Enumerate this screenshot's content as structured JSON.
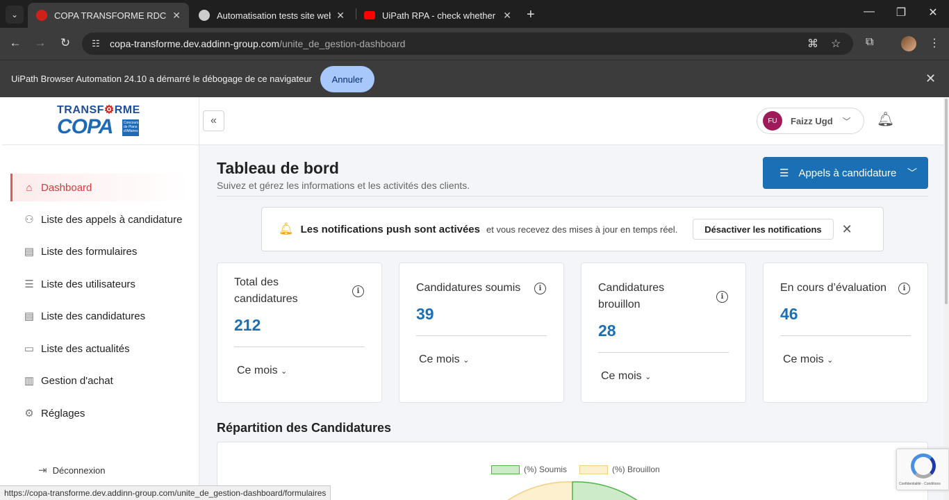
{
  "browser": {
    "tabs": [
      {
        "title": "COPA TRANSFORME RDC",
        "favicon_color": "#d0201a",
        "active": true
      },
      {
        "title": "Automatisation tests site web",
        "favicon_color": "#cccccc",
        "active": false
      },
      {
        "title": "UiPath RPA - check whether the",
        "favicon_color": "#ff0000",
        "active": false
      }
    ],
    "url_host": "copa-transforme.dev.addinn-group.com",
    "url_path": "/unite_de_gestion-dashboard",
    "infobar": {
      "message": "UiPath Browser Automation 24.10 a démarré le débogage de ce navigateur",
      "button": "Annuler"
    },
    "status_url": "https://copa-transforme.dev.addinn-group.com/unite_de_gestion-dashboard/formulaires"
  },
  "logo": {
    "line1_pre": "TRANSF",
    "line1_post": "RME",
    "line2": "COPA",
    "badge": "Concours de Plans d'Affaires"
  },
  "sidebar": {
    "items": [
      {
        "label": "Dashboard",
        "icon": "home-icon",
        "glyph": "⌂"
      },
      {
        "label": "Liste des appels à candidature",
        "icon": "megaphone-icon",
        "glyph": "⚇"
      },
      {
        "label": "Liste des formulaires",
        "icon": "form-icon",
        "glyph": "▤"
      },
      {
        "label": "Liste des utilisateurs",
        "icon": "users-list-icon",
        "glyph": "☰"
      },
      {
        "label": "Liste des candidatures",
        "icon": "document-icon",
        "glyph": "▤"
      },
      {
        "label": "Liste des actualités",
        "icon": "news-icon",
        "glyph": "▭"
      },
      {
        "label": "Gestion d'achat",
        "icon": "receipt-icon",
        "glyph": "▥"
      },
      {
        "label": "Réglages",
        "icon": "gear-icon",
        "glyph": "⚙"
      }
    ],
    "logout": "Déconnexion"
  },
  "user": {
    "initials": "FU",
    "name": "Faizz Ugd"
  },
  "header": {
    "title": "Tableau de bord",
    "subtitle": "Suivez et gérez les informations et les activités des clients.",
    "cta": "Appels à candidature"
  },
  "notification": {
    "strong": "Les notifications push sont activées",
    "text": "et vous recevez des mises à jour en temps réel.",
    "button": "Désactiver les notifications"
  },
  "cards": [
    {
      "title": "Total des candidatures",
      "value": "212",
      "period": "Ce mois"
    },
    {
      "title": "Candidatures soumis",
      "value": "39",
      "period": "Ce mois"
    },
    {
      "title": "Candidatures brouillon",
      "value": "28",
      "period": "Ce mois"
    },
    {
      "title": "En cours d’évaluation",
      "value": "46",
      "period": "Ce mois"
    }
  ],
  "repartition": {
    "title": "Répartition des Candidatures",
    "legend": [
      "(%) Soumis",
      "(%) Brouillon"
    ]
  },
  "recaptcha": {
    "text": "Confidentialité - Conditions"
  }
}
